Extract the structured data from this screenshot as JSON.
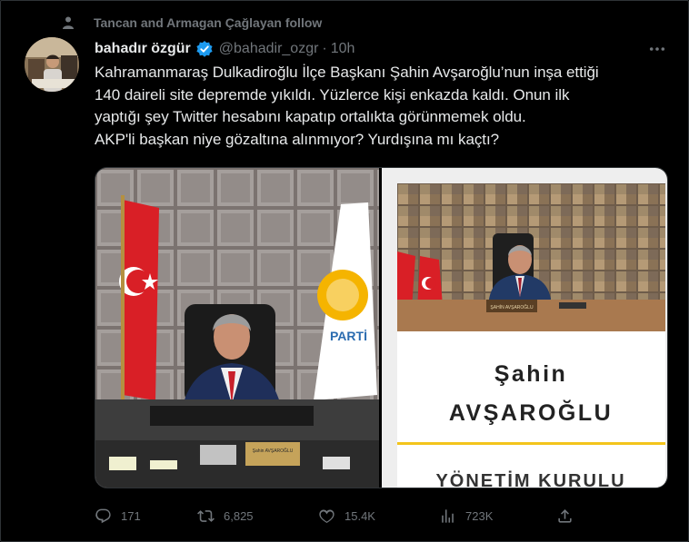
{
  "social_context": {
    "text": "Tancan and Armagan Çağlayan follow",
    "icon": "person-icon"
  },
  "author": {
    "display_name": "bahadır özgür",
    "handle": "@bahadir_ozgr",
    "separator": "·",
    "time": "10h",
    "verified_icon": "verified-badge-icon"
  },
  "tweet": {
    "text": "Kahramanmaraş Dulkadiroğlu İlçe Başkanı Şahin Avşaroğlu’nun inşa ettiği\n140 daireli site depremde yıkıldı. Yüzlerce kişi enkazda kaldı. Onun ilk\nyaptığı şey Twitter hesabını kapatıp ortalıkta görünmemek oldu.\nAKP'li başkan niye gözaltına alınmıyor? Yurdışına mı kaçtı?"
  },
  "media": {
    "left_nameplate": "Şahin AVŞAROĞLU",
    "right_card": {
      "nameplate": "ŞAHİN AVŞAROĞLU",
      "name_line1": "Şahin",
      "name_line2": "AVŞAROĞLU",
      "role": "YÖNETİM KURULU",
      "accent": "#f3c41b"
    }
  },
  "actions": {
    "reply_count": "171",
    "retweet_count": "6,825",
    "like_count": "15.4K",
    "views_count": "723K"
  },
  "colors": {
    "background": "#000000",
    "text": "#e7e9ea",
    "muted": "#71767b",
    "verified": "#1d9bf0",
    "border": "#2f3336"
  }
}
